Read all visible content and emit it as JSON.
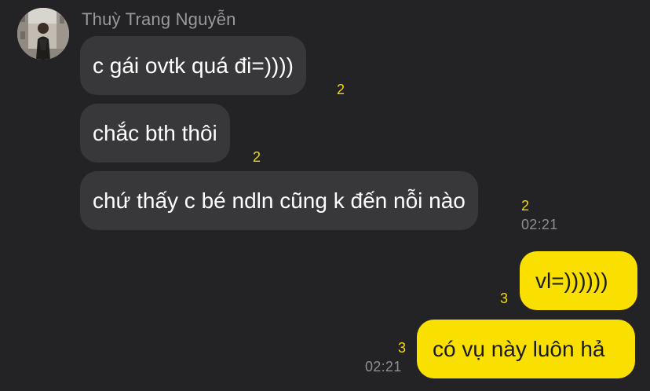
{
  "chat": {
    "sender_name": "Thuỳ Trang Nguyễn",
    "incoming": [
      {
        "text": "c gái ovtk quá đi=))))",
        "unread": "2"
      },
      {
        "text": "chắc bth thôi",
        "unread": "2"
      },
      {
        "text": "chứ thấy c bé ndln cũng k đến nỗi nào",
        "unread": "2",
        "time": "02:21"
      }
    ],
    "outgoing": [
      {
        "text": "vl=))))))",
        "unread": "3"
      },
      {
        "text": "có vụ này luôn hả",
        "unread": "3",
        "time": "02:21"
      }
    ]
  },
  "colors": {
    "background": "#232325",
    "incoming_bubble": "#38383a",
    "outgoing_bubble": "#f9e000",
    "unread_count": "#f5d800",
    "timestamp": "#8e8e92"
  },
  "icons": {
    "avatar": "profile-photo"
  }
}
